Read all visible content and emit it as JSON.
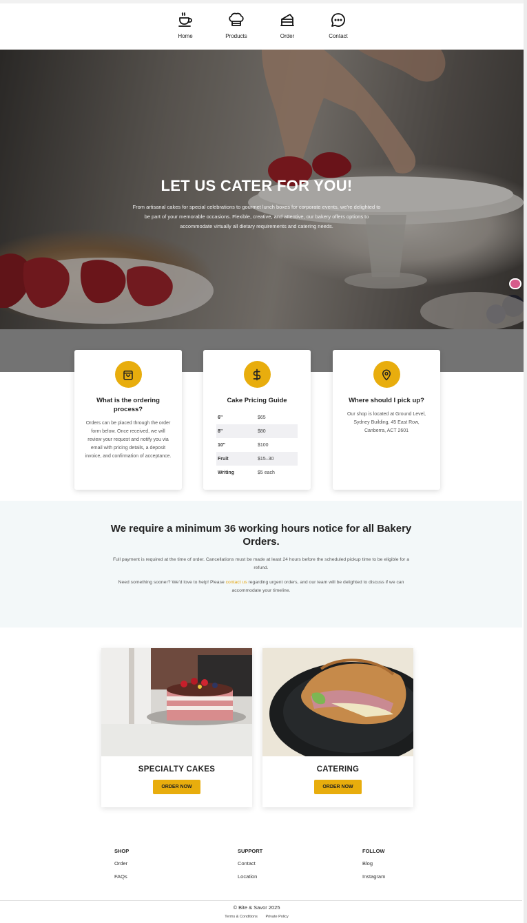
{
  "nav": {
    "items": [
      {
        "label": "Home",
        "icon": "coffee-cup-icon"
      },
      {
        "label": "Products",
        "icon": "chef-hat-icon"
      },
      {
        "label": "Order",
        "icon": "cake-slice-icon"
      },
      {
        "label": "Contact",
        "icon": "chat-bubble-icon"
      }
    ]
  },
  "hero": {
    "title": "LET US CATER FOR YOU!",
    "text": "From artisanal cakes for special celebrations to gourmet lunch boxes for corporate events, we're delighted to be part of your memorable occasions. Flexible, creative, and attentive, our bakery offers options to accommodate virtually all dietary requirements and catering needs."
  },
  "info": {
    "ordering": {
      "icon": "shopping-bag-icon",
      "title": "What is the ordering process?",
      "text": "Orders can be placed through the order form below. Once received, we will review your request and notify you via email with pricing details, a deposit invoice, and confirmation of acceptance."
    },
    "pricing": {
      "icon": "dollar-icon",
      "title": "Cake Pricing Guide",
      "rows": [
        {
          "size": "6\"",
          "price": "$65"
        },
        {
          "size": "8\"",
          "price": "$80"
        },
        {
          "size": "10\"",
          "price": "$100"
        },
        {
          "size": "Fruit",
          "price": "$15–30"
        },
        {
          "size": "Writing",
          "price": "$5 each"
        }
      ]
    },
    "pickup": {
      "icon": "location-pin-icon",
      "title": "Where should I pick up?",
      "text": "Our shop is located at Ground Level, Sydney Building, 45 East Row, Canberra, ACT 2601"
    }
  },
  "notice": {
    "title": "We require a minimum 36 working hours notice for all Bakery Orders.",
    "p1": "Full payment is required at the time of order. Cancellations must be made at least 24 hours before the scheduled pickup time to be eligible for a refund.",
    "p2_before": "Need something sooner? We'd love to help! Please ",
    "p2_link": "contact us",
    "p2_after": " regarding urgent orders, and our team will be delighted to discuss if we can accommodate your timeline."
  },
  "products": [
    {
      "name": "SPECIALTY CAKES",
      "button": "ORDER NOW"
    },
    {
      "name": "CATERING",
      "button": "ORDER NOW"
    }
  ],
  "footer": {
    "shop": {
      "heading": "SHOP",
      "links": [
        "Order",
        "FAQs"
      ]
    },
    "support": {
      "heading": "SUPPORT",
      "links": [
        "Contact",
        "Location"
      ]
    },
    "follow": {
      "heading": "FOLLOW",
      "links": [
        "Blog",
        "Instagram"
      ]
    },
    "copyright": "© Bite & Savor 2025",
    "terms": "Terms & Conditions",
    "privacy": "Private Policy"
  },
  "colors": {
    "accent": "#e8ad0d",
    "link": "#e3a20b",
    "notice_bg": "#f3f8f9",
    "band": "#737373"
  }
}
